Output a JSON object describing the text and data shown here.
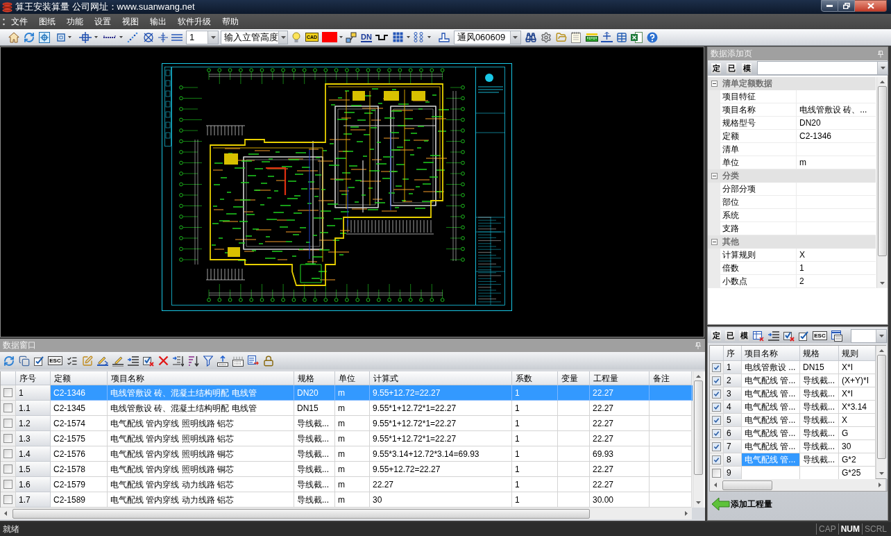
{
  "window": {
    "title": "算王安装算量 公司网址：www.suanwang.net"
  },
  "menu": [
    "文件",
    "图纸",
    "功能",
    "设置",
    "视图",
    "输出",
    "软件升级",
    "帮助"
  ],
  "toolbar": {
    "combos": [
      {
        "value": "1"
      },
      {
        "value": "输入立管高度"
      },
      {
        "value": "通风060609"
      }
    ],
    "icon_labels": [
      "CAD",
      "DN"
    ],
    "color_swatch": {
      "color": "#ff0000"
    }
  },
  "property_panel": {
    "title": "数据添加页",
    "tool_buttons": [
      "定",
      "已",
      "模"
    ],
    "groups": [
      {
        "name": "清单定额数据",
        "expanded": true,
        "rows": [
          {
            "label": "项目特征"
          },
          {
            "label": "项目名称",
            "value": "电线管敷设 砖、..."
          },
          {
            "label": "规格型号",
            "value": "DN20"
          },
          {
            "label": "定额",
            "value": "C2-1346"
          },
          {
            "label": "清单"
          },
          {
            "label": "单位",
            "value": "m"
          }
        ]
      },
      {
        "name": "分类",
        "expanded": true,
        "rows": [
          {
            "label": "分部分项"
          },
          {
            "label": "部位"
          },
          {
            "label": "系统"
          },
          {
            "label": "支路"
          }
        ]
      },
      {
        "name": "其他",
        "expanded": true,
        "rows": [
          {
            "label": "计算规则",
            "value": "X"
          },
          {
            "label": "倍数",
            "value": "1"
          },
          {
            "label": "小数点",
            "value": "2"
          }
        ]
      }
    ]
  },
  "data_window": {
    "title": "数据窗口",
    "toolbar_label": "ESC",
    "columns": [
      "序号",
      "定额",
      "项目名称",
      "规格",
      "单位",
      "计算式",
      "系数",
      "变量",
      "工程量",
      "备注"
    ],
    "rows": [
      {
        "checked": false,
        "selected": true,
        "no": "1",
        "quota": "C2-1346",
        "name": "电线管敷设 砖、混凝土结构明配 电线管",
        "spec": "DN20",
        "unit": "m",
        "formula": "9.55+12.72=22.27",
        "coef": "1",
        "quantity": "22.27"
      },
      {
        "checked": false,
        "selected": false,
        "no": "1.1",
        "quota": "C2-1345",
        "name": "电线管敷设 砖、混凝土结构明配 电线管",
        "spec": "DN15",
        "unit": "m",
        "formula": "9.55*1+12.72*1=22.27",
        "coef": "1",
        "quantity": "22.27"
      },
      {
        "checked": false,
        "selected": false,
        "no": "1.2",
        "quota": "C2-1574",
        "name": "电气配线 管内穿线 照明线路 铝芯",
        "spec": "导线截...",
        "unit": "m",
        "formula": "9.55*1+12.72*1=22.27",
        "coef": "1",
        "quantity": "22.27"
      },
      {
        "checked": false,
        "selected": false,
        "no": "1.3",
        "quota": "C2-1575",
        "name": "电气配线 管内穿线 照明线路 铝芯",
        "spec": "导线截...",
        "unit": "m",
        "formula": "9.55*1+12.72*1=22.27",
        "coef": "1",
        "quantity": "22.27"
      },
      {
        "checked": false,
        "selected": false,
        "no": "1.4",
        "quota": "C2-1576",
        "name": "电气配线 管内穿线 照明线路 铜芯",
        "spec": "导线截...",
        "unit": "m",
        "formula": "9.55*3.14+12.72*3.14=69.93",
        "coef": "1",
        "quantity": "69.93"
      },
      {
        "checked": false,
        "selected": false,
        "no": "1.5",
        "quota": "C2-1578",
        "name": "电气配线 管内穿线 照明线路 铜芯",
        "spec": "导线截...",
        "unit": "m",
        "formula": "9.55+12.72=22.27",
        "coef": "1",
        "quantity": "22.27"
      },
      {
        "checked": false,
        "selected": false,
        "no": "1.6",
        "quota": "C2-1579",
        "name": "电气配线 管内穿线 动力线路 铝芯",
        "spec": "导线截...",
        "unit": "m",
        "formula": "22.27",
        "coef": "1",
        "quantity": "22.27"
      },
      {
        "checked": false,
        "selected": false,
        "no": "1.7",
        "quota": "C2-1589",
        "name": "电气配线 管内穿线 动力线路 铝芯",
        "spec": "导线截...",
        "unit": "m",
        "formula": "30",
        "coef": "1",
        "quantity": "30.00"
      }
    ]
  },
  "quantity_list": {
    "tool_buttons": [
      "定",
      "已",
      "模"
    ],
    "toolbar_label": "ESC",
    "columns": [
      "序",
      "项目名称",
      "规格",
      "规则"
    ],
    "rows": [
      {
        "checked": true,
        "selected": false,
        "no": "1",
        "name": "电线管敷设 ...",
        "spec": "DN15",
        "rule": "X*I"
      },
      {
        "checked": true,
        "selected": false,
        "no": "2",
        "name": "电气配线 管...",
        "spec": "导线截...",
        "rule": "(X+Y)*I"
      },
      {
        "checked": true,
        "selected": false,
        "no": "3",
        "name": "电气配线 管...",
        "spec": "导线截...",
        "rule": "X*I"
      },
      {
        "checked": true,
        "selected": false,
        "no": "4",
        "name": "电气配线 管...",
        "spec": "导线截...",
        "rule": "X*3.14"
      },
      {
        "checked": true,
        "selected": false,
        "no": "5",
        "name": "电气配线 管...",
        "spec": "导线截...",
        "rule": "X"
      },
      {
        "checked": true,
        "selected": false,
        "no": "6",
        "name": "电气配线 管...",
        "spec": "导线截...",
        "rule": "G"
      },
      {
        "checked": true,
        "selected": false,
        "no": "7",
        "name": "电气配线 管...",
        "spec": "导线截...",
        "rule": "30"
      },
      {
        "checked": true,
        "selected": true,
        "no": "8",
        "name": "电气配线 管...",
        "spec": "导线截...",
        "rule": "G*2"
      },
      {
        "checked": false,
        "selected": false,
        "no": "9",
        "rule": "G*25"
      }
    ],
    "add_button": "添加工程量"
  },
  "status_bar": {
    "text": "就绪",
    "indicators": [
      {
        "label": "CAP",
        "on": false
      },
      {
        "label": "NUM",
        "on": true
      },
      {
        "label": "SCRL",
        "on": false
      }
    ]
  }
}
